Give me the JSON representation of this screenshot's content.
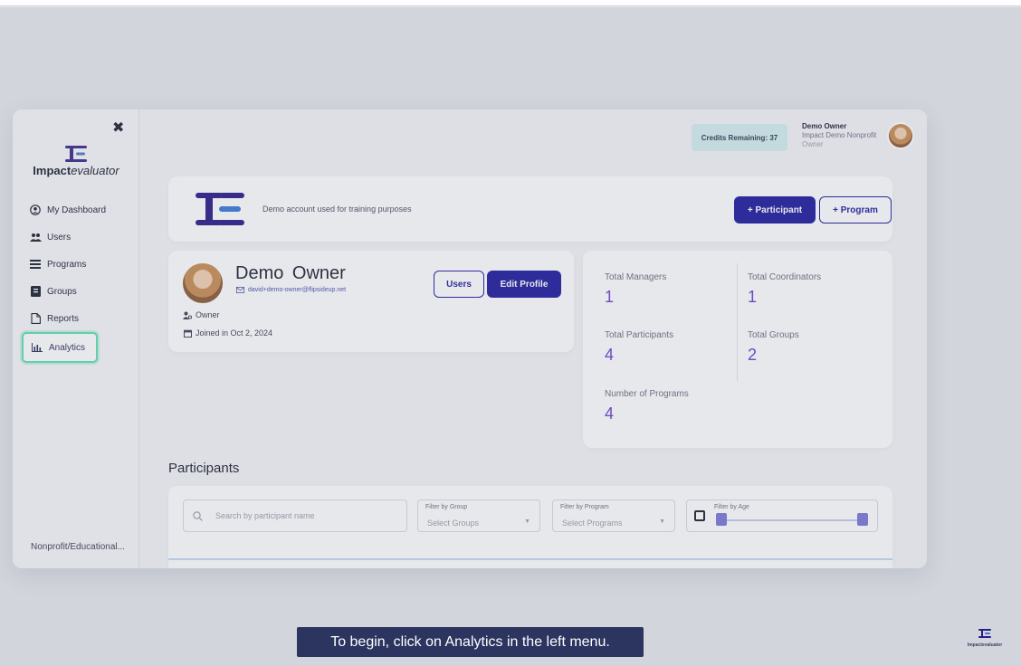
{
  "sidebar": {
    "brand_bold": "Impact",
    "brand_thin": "evaluator",
    "items": [
      {
        "label": "My Dashboard"
      },
      {
        "label": "Users"
      },
      {
        "label": "Programs"
      },
      {
        "label": "Groups"
      },
      {
        "label": "Reports"
      },
      {
        "label": "Analytics"
      }
    ],
    "footer": "Nonprofit/Educational..."
  },
  "header": {
    "credits": "Credits Remaining: 37",
    "user_name": "Demo Owner",
    "user_org": "Impact Demo Nonprofit",
    "user_role": "Owner"
  },
  "org": {
    "description": "Demo account used for training purposes",
    "add_participant": "+ Participant",
    "add_program": "+ Program"
  },
  "profile": {
    "name": "Demo Owner",
    "email": "david+demo-owner@flipsideup.net",
    "users_button": "Users",
    "edit_button": "Edit Profile",
    "role": "Owner",
    "joined": "Joined in Oct 2, 2024"
  },
  "stats": {
    "total_managers_label": "Total Managers",
    "total_managers": "1",
    "total_coordinators_label": "Total Coordinators",
    "total_coordinators": "1",
    "total_participants_label": "Total Participants",
    "total_participants": "4",
    "total_groups_label": "Total Groups",
    "total_groups": "2",
    "number_of_programs_label": "Number of Programs",
    "number_of_programs": "4"
  },
  "participants": {
    "title": "Participants",
    "search_placeholder": "Search by participant name",
    "group_caption": "Filter by Group",
    "group_value": "Select Groups",
    "program_caption": "Filter by Program",
    "program_value": "Select Programs",
    "age_caption": "Filter by Age",
    "age_range_min_fraction": 0,
    "age_range_max_fraction": 1
  },
  "caption": "To begin, click on Analytics in the left menu.",
  "brand_corner": "Impactevaluator",
  "colors": {
    "primary": "#1e1a9e",
    "stat_value": "#6a3fd0",
    "highlight": "#5ee0b0",
    "caption_bg": "#2c3560"
  },
  "icons": [
    "close-icon",
    "user-circle-icon",
    "users-icon",
    "list-icon",
    "book-icon",
    "document-icon",
    "bar-chart-icon",
    "mail-icon",
    "user-role-icon",
    "calendar-icon",
    "search-icon",
    "chevron-down-icon"
  ]
}
